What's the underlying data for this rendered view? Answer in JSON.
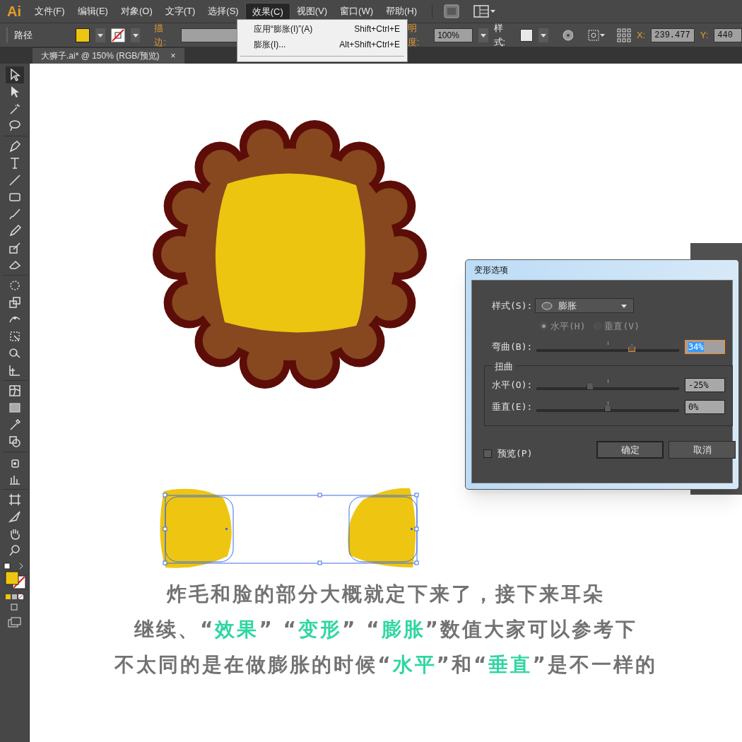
{
  "app": {
    "logo": "Ai"
  },
  "menu": [
    {
      "label": "文件(F)",
      "selected": false
    },
    {
      "label": "编辑(E)",
      "selected": false
    },
    {
      "label": "对象(O)",
      "selected": false
    },
    {
      "label": "文字(T)",
      "selected": false
    },
    {
      "label": "选择(S)",
      "selected": false
    },
    {
      "label": "效果(C)",
      "selected": true
    },
    {
      "label": "视图(V)",
      "selected": false
    },
    {
      "label": "窗口(W)",
      "selected": false
    },
    {
      "label": "帮助(H)",
      "selected": false
    }
  ],
  "effect_menu": [
    {
      "label": "应用“膨胀(I)”(A)",
      "shortcut": "Shift+Ctrl+E"
    },
    {
      "label": "膨胀(I)...",
      "shortcut": "Alt+Shift+Ctrl+E"
    }
  ],
  "control_bar": {
    "object_type": "路径",
    "stroke_label": "描边:",
    "opacity_label": "明度:",
    "opacity_value": "100%",
    "style_label": "样式:",
    "x_label": "X:",
    "x_value": "239.477",
    "y_label": "Y:",
    "y_value": "440"
  },
  "document_tab": {
    "title": "大狮子.ai* @ 150% (RGB/预览)",
    "close": "×"
  },
  "dialog": {
    "title": "变形选项",
    "style_label": "样式(S):",
    "style_value": "膨胀",
    "orientation": [
      {
        "label": "水平(H)",
        "selected": true
      },
      {
        "label": "垂直(V)",
        "selected": false
      }
    ],
    "orientation_disabled": true,
    "bend": {
      "label": "弯曲(B):",
      "level": 0.67,
      "value": "34%",
      "focused": true
    },
    "distortion_title": "扭曲",
    "distortion": [
      {
        "label": "水平(O):",
        "level": 0.375,
        "value": "-25%"
      },
      {
        "label": "垂直(E):",
        "level": 0.5,
        "value": "0%"
      }
    ],
    "preview": {
      "label": "预览(P)",
      "checked": false
    },
    "buttons": [
      "确定",
      "取消"
    ]
  },
  "caption": [
    [
      {
        "text": "炸毛和脸的部分大概就定下来了，接下来耳朵",
        "highlight": false
      }
    ],
    [
      {
        "text": "继续、“",
        "highlight": false
      },
      {
        "text": "效果",
        "highlight": true
      },
      {
        "text": "” “",
        "highlight": false
      },
      {
        "text": "变形",
        "highlight": true
      },
      {
        "text": "” “",
        "highlight": false
      },
      {
        "text": "膨胀",
        "highlight": true
      },
      {
        "text": "”数值大家可以参考下",
        "highlight": false
      }
    ],
    [
      {
        "text": "不太同的是在做膨胀的时候“",
        "highlight": false
      },
      {
        "text": "水平",
        "highlight": true
      },
      {
        "text": "”和“",
        "highlight": false
      },
      {
        "text": "垂直",
        "highlight": true
      },
      {
        "text": "”是不一样的",
        "highlight": false
      }
    ]
  ]
}
